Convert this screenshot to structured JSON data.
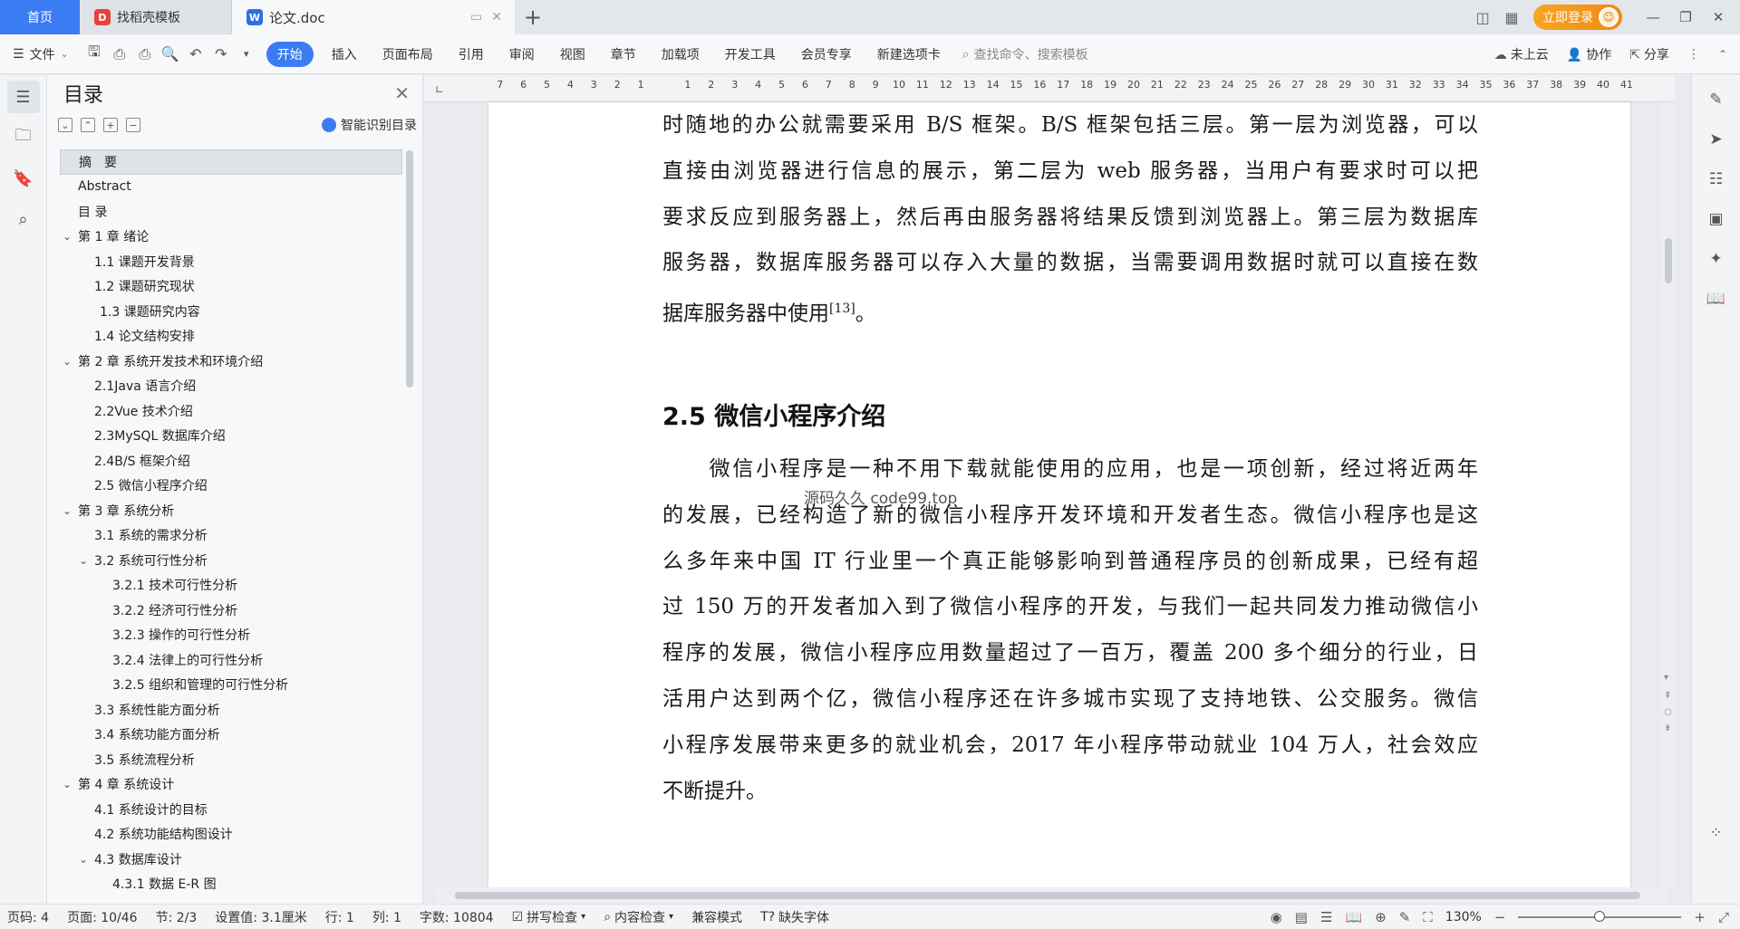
{
  "titlebar": {
    "home_tab": "首页",
    "tabs": [
      {
        "label": "找稻壳模板",
        "icon": "daoke-icon"
      },
      {
        "label": "论文.doc",
        "icon": "wps-writer-icon"
      }
    ],
    "login_label": "立即登录"
  },
  "menubar": {
    "file_label": "文件",
    "items": [
      "开始",
      "插入",
      "页面布局",
      "引用",
      "审阅",
      "视图",
      "章节",
      "加载项",
      "开发工具",
      "会员专享",
      "新建选项卡"
    ],
    "active_item": "开始",
    "search_placeholder": "查找命令、搜索模板",
    "cloud_label": "未上云",
    "collab_label": "协作",
    "share_label": "分享"
  },
  "toc": {
    "title": "目录",
    "smart_label": "智能识别目录",
    "items": [
      {
        "label": "摘　要",
        "level": 0,
        "arrow": false,
        "selected": true
      },
      {
        "label": "Abstract",
        "level": 0,
        "arrow": false
      },
      {
        "label": "目 录",
        "level": 0,
        "arrow": false
      },
      {
        "label": "第 1 章  绪论",
        "level": 0,
        "arrow": true
      },
      {
        "label": "1.1 课题开发背景",
        "level": 1
      },
      {
        "label": "1.2 课题研究现状",
        "level": 1
      },
      {
        "label": "1.3 课题研究内容",
        "level": 1.3
      },
      {
        "label": "1.4 论文结构安排",
        "level": 1
      },
      {
        "label": "第 2 章  系统开发技术和环境介绍",
        "level": 0,
        "arrow": true
      },
      {
        "label": "2.1Java 语言介绍",
        "level": 1
      },
      {
        "label": "2.2Vue 技术介绍",
        "level": 1
      },
      {
        "label": "2.3MySQL 数据库介绍",
        "level": 1
      },
      {
        "label": "2.4B/S 框架介绍",
        "level": 1
      },
      {
        "label": "2.5 微信小程序介绍",
        "level": 1
      },
      {
        "label": "第 3 章  系统分析",
        "level": 0,
        "arrow": true
      },
      {
        "label": "3.1 系统的需求分析",
        "level": 1
      },
      {
        "label": "3.2 系统可行性分析",
        "level": 1,
        "arrow": true
      },
      {
        "label": "3.2.1 技术可行性分析",
        "level": 2
      },
      {
        "label": "3.2.2 经济可行性分析",
        "level": 2
      },
      {
        "label": "3.2.3 操作的可行性分析",
        "level": 2
      },
      {
        "label": "3.2.4 法律上的可行性分析",
        "level": 2
      },
      {
        "label": "3.2.5 组织和管理的可行性分析",
        "level": 2
      },
      {
        "label": "3.3 系统性能方面分析",
        "level": 1
      },
      {
        "label": "3.4 系统功能方面分析",
        "level": 1
      },
      {
        "label": "3.5 系统流程分析",
        "level": 1
      },
      {
        "label": "第 4 章  系统设计",
        "level": 0,
        "arrow": true
      },
      {
        "label": "4.1 系统设计的目标",
        "level": 1
      },
      {
        "label": "4.2 系统功能结构图设计",
        "level": 1
      },
      {
        "label": "4.3 数据库设计",
        "level": 1,
        "arrow": true
      },
      {
        "label": "4.3.1 数据 E-R 图",
        "level": 2
      }
    ]
  },
  "ruler": {
    "left_ticks": [
      "7",
      "6",
      "5",
      "4",
      "3",
      "2",
      "1"
    ],
    "right_ticks": [
      "1",
      "2",
      "3",
      "4",
      "5",
      "6",
      "7",
      "8",
      "9",
      "10",
      "11",
      "12",
      "13",
      "14",
      "15",
      "16",
      "17",
      "18",
      "19",
      "20",
      "21",
      "22",
      "23",
      "24",
      "25",
      "26",
      "27",
      "28",
      "29",
      "30",
      "31",
      "32",
      "33",
      "34",
      "35",
      "36",
      "37",
      "38",
      "39",
      "40",
      "41"
    ]
  },
  "document": {
    "para1_lines": [
      "时随地的办公就需要采用 B/S 框架。B/S 框架包括三层。第一层为浏览器，可以",
      "直接由浏览器进行信息的展示，第二层为 web 服务器，当用户有要求时可以把",
      "要求反应到服务器上，然后再由服务器将结果反馈到浏览器上。第三层为数据库",
      "服务器，数据库服务器可以存入大量的数据，当需要调用数据时就可以直接在数"
    ],
    "para1_last": "据库服务器中使用",
    "para1_ref": "[13]",
    "para1_end": "。",
    "heading": "2.5 微信小程序介绍",
    "watermark": "源码久久 code99.top",
    "para2_lines": [
      "　　微信小程序是一种不用下载就能使用的应用，也是一项创新，经过将近两年",
      "的发展，已经构造了新的微信小程序开发环境和开发者生态。微信小程序也是这",
      "么多年来中国 IT 行业里一个真正能够影响到普通程序员的创新成果，已经有超",
      "过 150 万的开发者加入到了微信小程序的开发，与我们一起共同发力推动微信小",
      "程序的发展，微信小程序应用数量超过了一百万，覆盖 200 多个细分的行业，日",
      "活用户达到两个亿，微信小程序还在许多城市实现了支持地铁、公交服务。微信",
      "小程序发展带来更多的就业机会，2017 年小程序带动就业 104 万人，社会效应"
    ],
    "para2_last": "不断提升。"
  },
  "status": {
    "page_code": "页码: 4",
    "page": "页面: 10/46",
    "section": "节: 2/3",
    "setting": "设置值: 3.1厘米",
    "row": "行: 1",
    "col": "列: 1",
    "word_count": "字数: 10804",
    "spell_check": "拼写检查",
    "content_check": "内容检查",
    "compat_mode": "兼容模式",
    "missing_font": "缺失字体",
    "zoom": "130%",
    "zoom_level": 0.5
  }
}
